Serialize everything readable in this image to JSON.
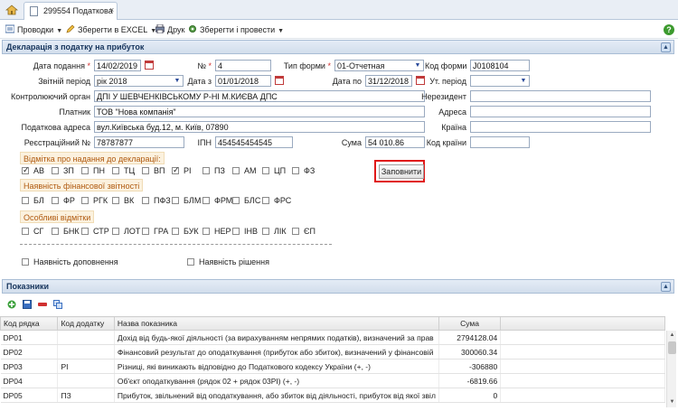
{
  "tab": {
    "title": "299554 Податкова",
    "close": "×"
  },
  "toolbar": {
    "entries": "Проводки",
    "excel": "Зберегти в EXCEL",
    "print": "Друк",
    "save_post": "Зберегти і провести"
  },
  "help": "?",
  "panel1": {
    "title": "Декларація з податку на прибуток",
    "collapse": "▲"
  },
  "form": {
    "date_submitted_label": "Дата подання",
    "date_submitted": "14/02/2019",
    "number_label": "№",
    "number": "4",
    "form_type_label": "Тип форми",
    "form_type": "01-Отчетная",
    "form_code_label": "Код форми",
    "form_code": "J0108104",
    "period_label": "Звітній період",
    "period": "рік 2018",
    "date_from_label": "Дата з",
    "date_from": "01/01/2018",
    "date_to_label": "Дата по",
    "date_to": "31/12/2018",
    "clar_period_label": "Ут. період",
    "clar_period": "",
    "authority_label": "Контролюючий орган",
    "authority": "ДПІ У ШЕВЧЕНКІВСЬКОМУ Р-НІ М.КИЄВА ДПС",
    "nonresident_label": "Нерезидент",
    "nonresident": "",
    "payer_label": "Платник",
    "payer": "ТОВ \"Нова компанія\"",
    "address_label": "Адреса",
    "address": "",
    "tax_address_label": "Податкова адреса",
    "tax_address": "вул.Київська буд.12, м. Київ, 07890",
    "country_label": "Країна",
    "country": "",
    "reg_no_label": "Реєстраційний №",
    "reg_no": "78787877",
    "ipn_label": "ІПН",
    "ipn": "454545454545",
    "sum_label": "Сума",
    "sum": "54 010.86",
    "country_code_label": "Код країни",
    "country_code": ""
  },
  "groups": {
    "marks_title": "Відмітка про надання до декларації:",
    "marks": [
      {
        "label": "АВ",
        "checked": true
      },
      {
        "label": "ЗП",
        "checked": false
      },
      {
        "label": "ПН",
        "checked": false
      },
      {
        "label": "ТЦ",
        "checked": false
      },
      {
        "label": "ВП",
        "checked": false
      },
      {
        "label": "РІ",
        "checked": true
      },
      {
        "label": "ПЗ",
        "checked": false
      },
      {
        "label": "АМ",
        "checked": false
      },
      {
        "label": "ЦП",
        "checked": false
      },
      {
        "label": "ФЗ",
        "checked": false
      }
    ],
    "fill_button": "Заповнити",
    "fin_title": "Наявність фінансової звітності",
    "fin": [
      {
        "label": "БЛ",
        "checked": false
      },
      {
        "label": "ФР",
        "checked": false
      },
      {
        "label": "РГК",
        "checked": false
      },
      {
        "label": "ВК",
        "checked": false
      },
      {
        "label": "ПФЗ",
        "checked": false
      },
      {
        "label": "БЛМ",
        "checked": false
      },
      {
        "label": "ФРМ",
        "checked": false
      },
      {
        "label": "БЛС",
        "checked": false
      },
      {
        "label": "ФРС",
        "checked": false
      }
    ],
    "special_title": "Особливі відмітки",
    "special": [
      {
        "label": "СГ",
        "checked": false
      },
      {
        "label": "БНК",
        "checked": false
      },
      {
        "label": "СТР",
        "checked": false
      },
      {
        "label": "ЛОТ",
        "checked": false
      },
      {
        "label": "ГРА",
        "checked": false
      },
      {
        "label": "БУК",
        "checked": false
      },
      {
        "label": "НЕР",
        "checked": false
      },
      {
        "label": "ІНВ",
        "checked": false
      },
      {
        "label": "ЛІК",
        "checked": false
      },
      {
        "label": "ЄП",
        "checked": false
      }
    ],
    "supplement_label": "Наявність доповнення",
    "decision_label": "Наявність рішення"
  },
  "panel2": {
    "title": "Показники",
    "collapse": "▲"
  },
  "grid": {
    "headers": [
      "Код рядка",
      "Код додатку",
      "Назва показника",
      "Сума"
    ],
    "rows": [
      {
        "code": "DP01",
        "app": "",
        "name": "Дохід від будь-якої діяльності (за вирахуванням непрямих податків), визначений за прав",
        "sum": "2794128.04"
      },
      {
        "code": "DP02",
        "app": "",
        "name": "Фінансовий результат до оподаткування (прибуток або збиток), визначений у фінансовій",
        "sum": "300060.34"
      },
      {
        "code": "DP03",
        "app": "РІ",
        "name": "Різниці, які виникають відповідно до Податкового кодексу України (+, -)",
        "sum": "-306880"
      },
      {
        "code": "DP04",
        "app": "",
        "name": "Об'єкт оподаткування (рядок 02 + рядок 03РІ) (+, -)",
        "sum": "-6819.66"
      },
      {
        "code": "DP05",
        "app": "ПЗ",
        "name": "Прибуток, звільнений від оподаткування, або збиток від діяльності, прибуток від якої звіл",
        "sum": "0"
      }
    ]
  },
  "colors": {
    "accent": "#15335b",
    "highlight": "#e01818",
    "group_text": "#b05a10"
  }
}
